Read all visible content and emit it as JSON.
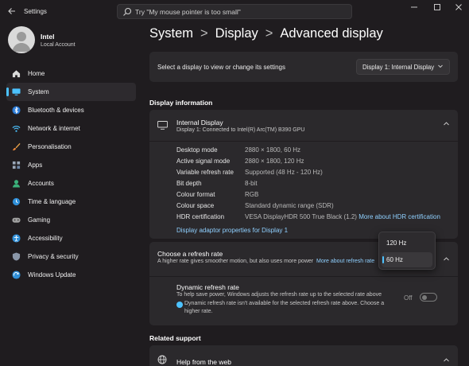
{
  "window": {
    "app_title": "Settings",
    "back_icon": "back-arrow-icon",
    "controls": [
      "minimize-icon",
      "maximize-icon",
      "close-icon"
    ]
  },
  "search": {
    "placeholder": "Try \"My mouse pointer is too small\""
  },
  "user": {
    "name": "Intel",
    "account_type": "Local Account"
  },
  "sidebar": {
    "items": [
      {
        "label": "Home",
        "icon": "home-icon"
      },
      {
        "label": "System",
        "icon": "system-icon",
        "active": true
      },
      {
        "label": "Bluetooth & devices",
        "icon": "bluetooth-icon"
      },
      {
        "label": "Network & internet",
        "icon": "wifi-icon"
      },
      {
        "label": "Personalisation",
        "icon": "brush-icon"
      },
      {
        "label": "Apps",
        "icon": "apps-icon"
      },
      {
        "label": "Accounts",
        "icon": "accounts-icon"
      },
      {
        "label": "Time & language",
        "icon": "globe-clock-icon"
      },
      {
        "label": "Gaming",
        "icon": "gamepad-icon"
      },
      {
        "label": "Accessibility",
        "icon": "accessibility-icon"
      },
      {
        "label": "Privacy & security",
        "icon": "shield-icon"
      },
      {
        "label": "Windows Update",
        "icon": "update-icon"
      }
    ]
  },
  "breadcrumb": {
    "items": [
      "System",
      "Display",
      "Advanced display"
    ],
    "separator": ">"
  },
  "display_select": {
    "label": "Select a display to view or change its settings",
    "value": "Display 1: Internal Display"
  },
  "display_info": {
    "section_title": "Display information",
    "name": "Internal Display",
    "description": "Display 1: Connected to Intel(R) Arc(TM) B390 GPU",
    "rows": [
      {
        "key": "Desktop mode",
        "value": "2880 × 1800, 60 Hz"
      },
      {
        "key": "Active signal mode",
        "value": "2880 × 1800, 120 Hz"
      },
      {
        "key": "Variable refresh rate",
        "value": "Supported (48 Hz - 120 Hz)"
      },
      {
        "key": "Bit depth",
        "value": "8-bit"
      },
      {
        "key": "Colour format",
        "value": "RGB"
      },
      {
        "key": "Colour space",
        "value": "Standard dynamic range (SDR)"
      },
      {
        "key": "HDR certification",
        "value": "VESA DisplayHDR 500 True Black (1.2)",
        "link": "More about HDR certification"
      }
    ],
    "adapter_link": "Display adaptor properties for Display 1"
  },
  "refresh_rate": {
    "title": "Choose a refresh rate",
    "description": "A higher rate gives smoother motion, but also uses more power",
    "link": "More about refresh rate",
    "options": [
      "120 Hz",
      "60 Hz"
    ],
    "selected": "60 Hz"
  },
  "dynamic_refresh": {
    "title": "Dynamic refresh rate",
    "description": "To help save power, Windows adjusts the refresh rate up to the selected rate above",
    "warning": "Dynamic refresh rate isn't available for the selected refresh rate above. Choose a higher rate.",
    "state": "Off"
  },
  "related_support": {
    "section_title": "Related support",
    "help_label": "Help from the web"
  },
  "colors": {
    "accent": "#4cc2ff",
    "background": "#1f1c1f",
    "card": "#2b292c",
    "link": "#8fd0ff"
  }
}
